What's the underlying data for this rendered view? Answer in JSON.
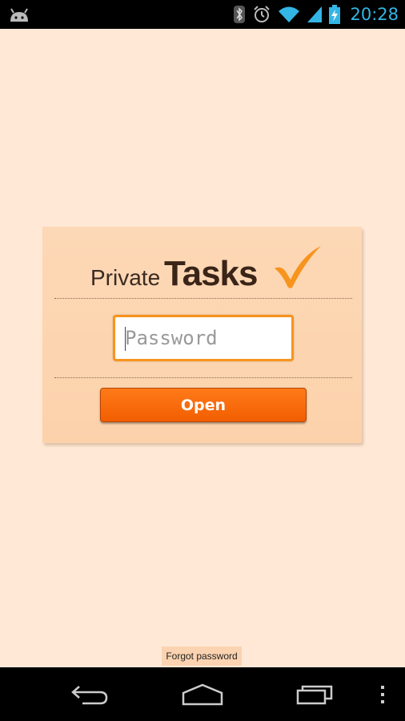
{
  "status_bar": {
    "time": "20:28",
    "icons": [
      "android-icon",
      "bluetooth-icon",
      "alarm-icon",
      "wifi-icon",
      "signal-icon",
      "battery-charging-icon"
    ],
    "accent_color": "#33b5e5"
  },
  "login": {
    "logo_private": "Private",
    "logo_tasks": "Tasks",
    "password_placeholder": "Password",
    "open_label": "Open",
    "accent_color": "#f25e00"
  },
  "footer": {
    "forgot_label": "Forgot password"
  },
  "nav_bar": {
    "icons": [
      "back-icon",
      "home-icon",
      "recent-apps-icon",
      "overflow-menu-icon"
    ]
  }
}
